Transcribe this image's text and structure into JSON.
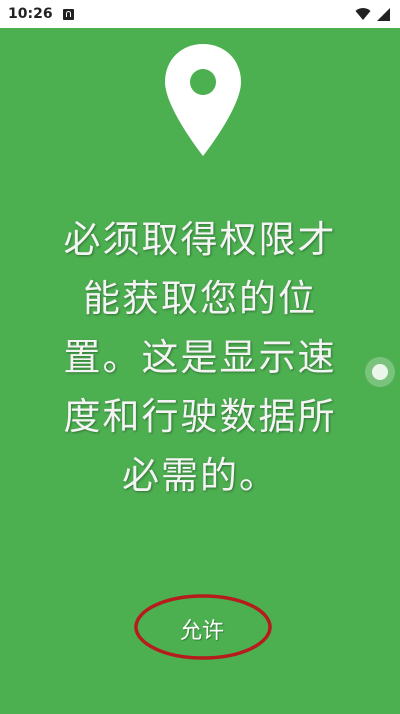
{
  "status_bar": {
    "time": "10:26",
    "icons": [
      "app-notification-icon",
      "wifi-icon",
      "cell-signal-icon"
    ]
  },
  "main": {
    "icon": "location-pin-icon",
    "message_lines": [
      "必须取得权限才",
      "能获取您的位",
      "置。这是显示速",
      "度和行驶数据所",
      "必需的。"
    ],
    "allow_label": "允许"
  },
  "colors": {
    "background": "#4caf50",
    "status_bar": "#ffffff",
    "text": "#f4f4f4",
    "highlight_ellipse": "#b71c1c"
  }
}
